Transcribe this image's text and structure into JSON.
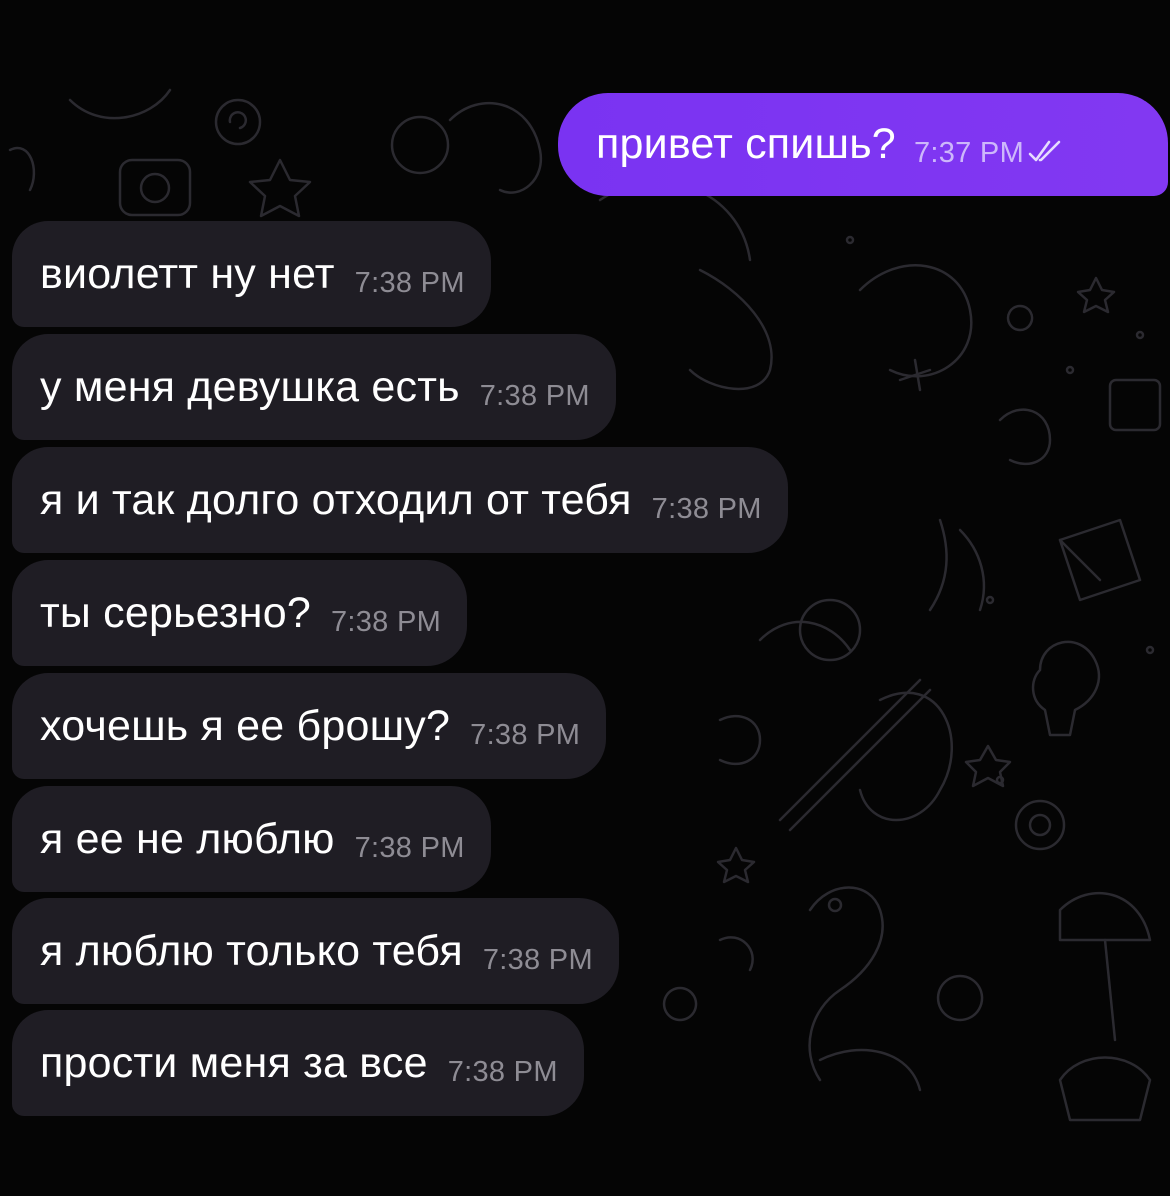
{
  "chat": {
    "accent_color": "#7c3aed",
    "incoming_bubble_color": "#1f1d24",
    "background_color": "#000000",
    "background_pattern_icon": "doodle-pattern",
    "outgoing": {
      "text": "привет спишь?",
      "time": "7:37 PM",
      "status_icon": "double-check-icon"
    },
    "messages": [
      {
        "text": "виолетт ну нет",
        "time": "7:38 PM"
      },
      {
        "text": "у меня девушка есть",
        "time": "7:38 PM"
      },
      {
        "text": "я и так долго отходил от тебя",
        "time": "7:38 PM"
      },
      {
        "text": "ты серьезно?",
        "time": "7:38 PM"
      },
      {
        "text": "хочешь я ее брошу?",
        "time": "7:38 PM"
      },
      {
        "text": "я ее не люблю",
        "time": "7:38 PM"
      },
      {
        "text": "я люблю только тебя",
        "time": "7:38 PM"
      },
      {
        "text": "прости меня за все",
        "time": "7:38 PM"
      }
    ]
  }
}
